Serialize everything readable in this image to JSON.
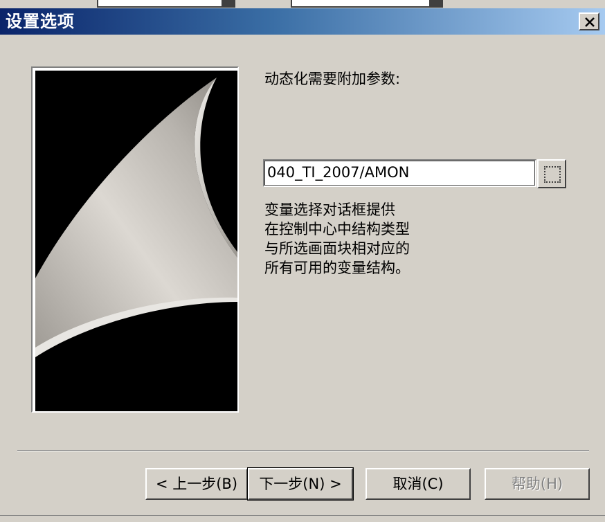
{
  "window": {
    "title": "设置选项",
    "close_icon": "close-icon"
  },
  "content": {
    "prompt_label": "动态化需要附加参数:",
    "param_value": "040_TI_2007/AMON",
    "browse_icon": "browse-dotted-icon",
    "description_lines": [
      "变量选择对话框提供",
      "在控制中心中结构类型",
      "与所选画面块相对应的",
      "所有可用的变量结构。"
    ]
  },
  "buttons": {
    "back": "< 上一步(B)",
    "next": "下一步(N) >",
    "cancel": "取消(C)",
    "help": "帮助(H)"
  },
  "colors": {
    "titlebar_start": "#0a246a",
    "titlebar_end": "#a6caf0",
    "face": "#d4d0c8"
  }
}
